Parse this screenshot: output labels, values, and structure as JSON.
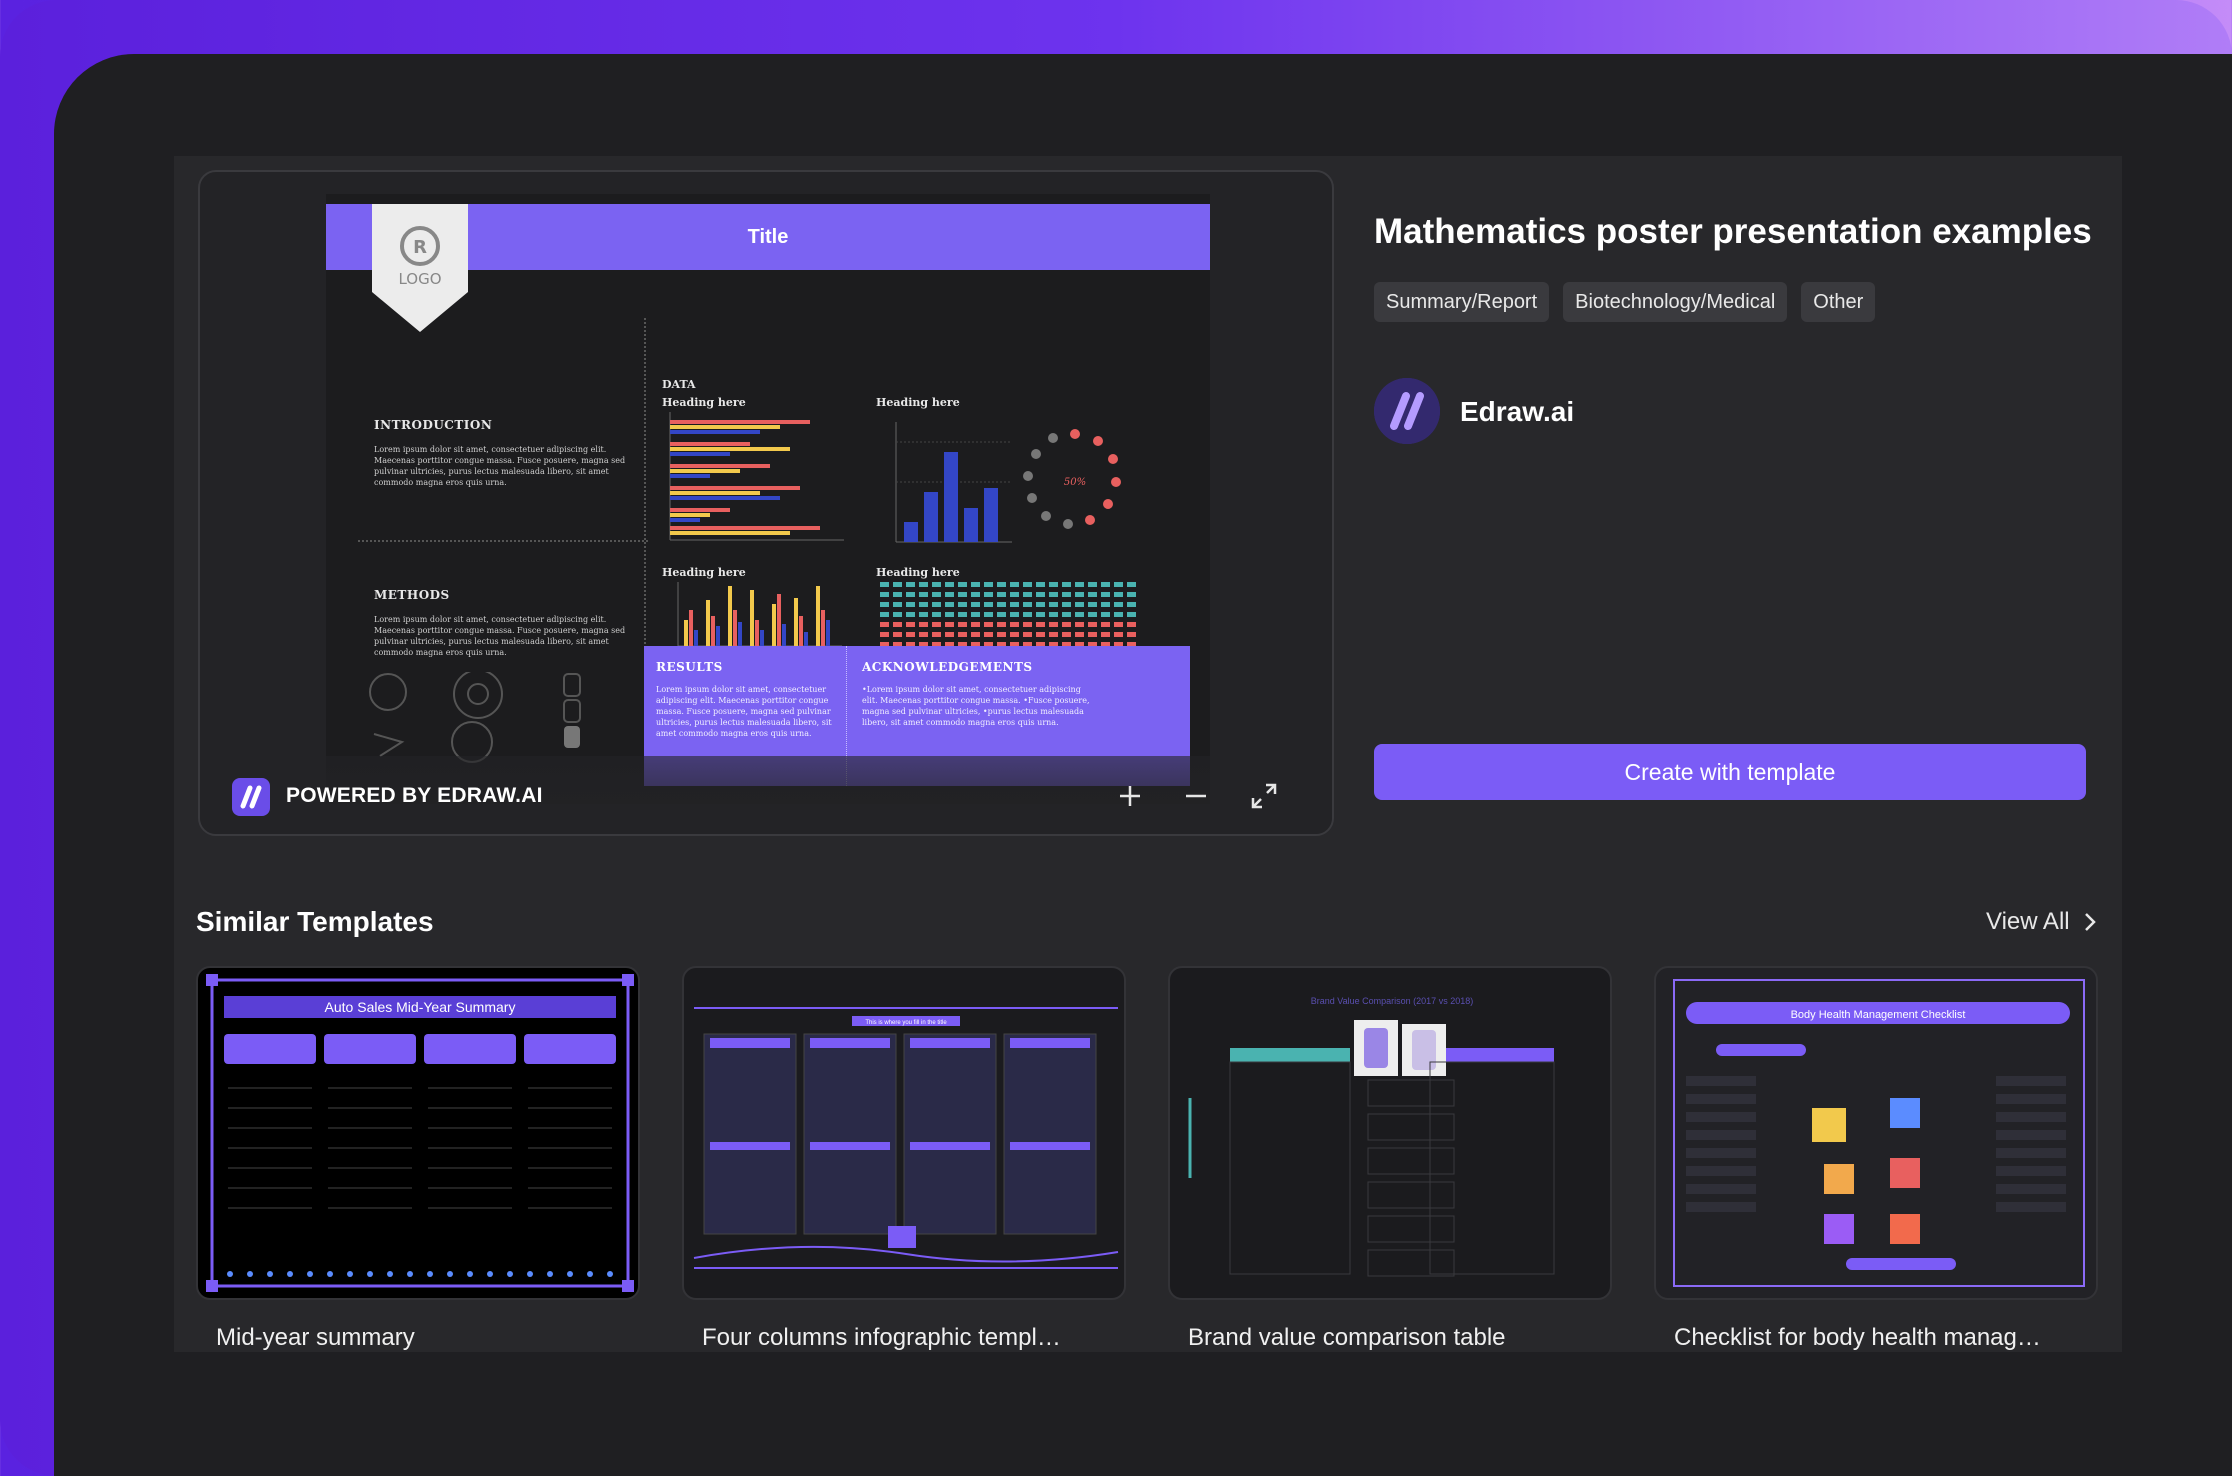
{
  "template": {
    "title": "Mathematics poster presentation examples",
    "tags": [
      "Summary/Report",
      "Biotechnology/Medical",
      "Other"
    ],
    "author": "Edraw.ai",
    "create_button": "Create with template"
  },
  "preview": {
    "powered_by": "POWERED BY EDRAW.AI",
    "zoom_in_icon": "plus-icon",
    "zoom_out_icon": "minus-icon",
    "fullscreen_icon": "fullscreen-icon",
    "poster": {
      "title": "Title",
      "logo": "LOGO",
      "introduction_label": "INTRODUCTION",
      "methods_label": "METHODS",
      "data_label": "DATA",
      "heading_1": "Heading here",
      "heading_2": "Heading here",
      "heading_3": "Heading here",
      "heading_4": "Heading here",
      "results_label": "RESULTS",
      "acknowledgements_label": "ACKNOWLEDGEMENTS",
      "lorem": "Lorem ipsum dolor sit amet, consectetuer adipiscing elit. Maecenas porttitor congue massa. Fusce posuere, magna sed pulvinar ultricies, purus lectus malesuada libero, sit amet commodo magna eros quis urna.",
      "ack_lorem": "•Lorem ipsum dolor sit amet, consectetuer adipiscing elit. Maecenas porttitor congue massa. •Fusce posuere, magna sed pulvinar ultricies, •purus lectus malesuada libero, sit amet commodo magna eros quis urna.",
      "donut_label": "50%"
    }
  },
  "similar": {
    "title": "Similar Templates",
    "view_all": "View All",
    "cards": [
      {
        "label": "Mid-year summary",
        "heading": "Auto Sales Mid-Year Summary"
      },
      {
        "label": "Four columns infographic templ…",
        "heading": "This is where you fill in the title"
      },
      {
        "label": "Brand value comparison table",
        "heading": "Brand Value Comparison (2017 vs 2018)"
      },
      {
        "label": "Checklist for body health manag…",
        "heading": "Body Health Management Checklist"
      }
    ]
  },
  "colors": {
    "accent": "#7b5cf6",
    "background": "#1f1f22",
    "bar_red": "#e8605f",
    "bar_yellow": "#f2c94c",
    "bar_blue": "#3346c6",
    "teal": "#4ab3b0"
  }
}
